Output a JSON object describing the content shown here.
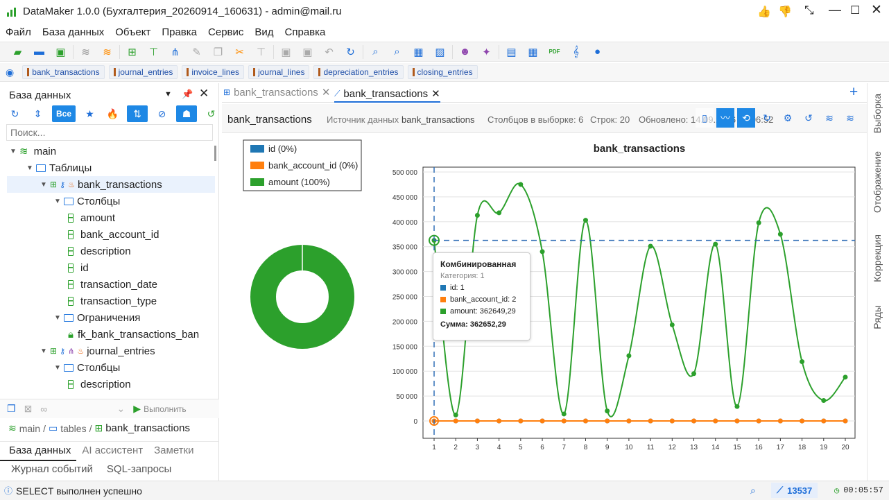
{
  "app": {
    "title": "DataMaker 1.0.0 (Бухгалтерия_20260914_160631) - admin@mail.ru"
  },
  "menu": [
    "Файл",
    "База данных",
    "Объект",
    "Правка",
    "Сервис",
    "Вид",
    "Справка"
  ],
  "table_tabs": [
    "bank_transactions",
    "journal_entries",
    "invoice_lines",
    "journal_lines",
    "depreciation_entries",
    "closing_entries"
  ],
  "left": {
    "header": "База данных",
    "filter_all": "Все",
    "search_placeholder": "Поиск...",
    "tree": [
      {
        "label": "main",
        "kind": "db",
        "depth": 0
      },
      {
        "label": "Таблицы",
        "kind": "folder",
        "depth": 1
      },
      {
        "label": "bank_transactions",
        "kind": "table",
        "depth": 2
      },
      {
        "label": "Столбцы",
        "kind": "folder",
        "depth": 3
      },
      {
        "label": "amount",
        "kind": "col",
        "depth": 4
      },
      {
        "label": "bank_account_id",
        "kind": "col",
        "depth": 4
      },
      {
        "label": "description",
        "kind": "col",
        "depth": 4
      },
      {
        "label": "id",
        "kind": "col",
        "depth": 4
      },
      {
        "label": "transaction_date",
        "kind": "col",
        "depth": 4
      },
      {
        "label": "transaction_type",
        "kind": "col",
        "depth": 4
      },
      {
        "label": "Ограничения",
        "kind": "folder",
        "depth": 3
      },
      {
        "label": "fk_bank_transactions_ban",
        "kind": "fk",
        "depth": 4
      },
      {
        "label": "journal_entries",
        "kind": "table",
        "depth": 2
      },
      {
        "label": "Столбцы",
        "kind": "folder",
        "depth": 3
      },
      {
        "label": "description",
        "kind": "col",
        "depth": 4
      }
    ],
    "run_label": "Выполнить",
    "breadcrumb": [
      "main",
      "tables",
      "bank_transactions"
    ],
    "bottom_tabs": [
      "База данных",
      "AI ассистент",
      "Заметки"
    ],
    "bottom_tabs2": [
      "Журнал событий",
      "SQL-запросы"
    ]
  },
  "doc_tabs": [
    "bank_transactions",
    "bank_transactions"
  ],
  "info": {
    "name": "bank_transactions",
    "source_label": "Источник данных",
    "source_value": "bank_transactions",
    "cols": "Столбцов в выборке: 6",
    "rows": "Строк: 20",
    "updated": "Обновлено: 14.09.2026 16:06:52"
  },
  "right_tabs": [
    "Выборка",
    "Отображение",
    "Коррекция",
    "Ряды"
  ],
  "tooltip": {
    "title": "Комбинированная",
    "category": "Категория: 1",
    "rows": [
      "id: 1",
      "bank_account_id: 2",
      "amount: 362649,29"
    ],
    "sum": "Сумма: 362652,29"
  },
  "status": {
    "message": "SELECT выполнен успешно",
    "count": "13537",
    "time": "00:05:57"
  },
  "colors": {
    "id": "#1f77b4",
    "bank_account_id": "#ff7f0e",
    "amount": "#2ca02c",
    "accent": "#1e88e5"
  },
  "chart_data": [
    {
      "type": "pie",
      "legend": [
        "id (0%)",
        "bank_account_id (0%)",
        "amount (100%)"
      ],
      "values": [
        0,
        0,
        100
      ]
    },
    {
      "type": "line",
      "title": "bank_transactions",
      "categories": [
        1,
        2,
        3,
        4,
        5,
        6,
        7,
        8,
        9,
        10,
        11,
        12,
        13,
        14,
        15,
        16,
        17,
        18,
        19,
        20
      ],
      "ylim": [
        0,
        500000
      ],
      "yticks": [
        "0",
        "50 000",
        "100 000",
        "150 000",
        "200 000",
        "250 000",
        "300 000",
        "350 000",
        "400 000",
        "450 000",
        "500 000"
      ],
      "series": [
        {
          "name": "id",
          "values": [
            1,
            2,
            3,
            4,
            5,
            6,
            7,
            8,
            9,
            10,
            11,
            12,
            13,
            14,
            15,
            16,
            17,
            18,
            19,
            20
          ]
        },
        {
          "name": "bank_account_id",
          "values": [
            2,
            1,
            3,
            2,
            1,
            3,
            2,
            1,
            2,
            3,
            1,
            2,
            3,
            1,
            2,
            3,
            1,
            2,
            3,
            1
          ]
        },
        {
          "name": "amount",
          "values": [
            362649,
            12000,
            413000,
            418000,
            475000,
            340000,
            14000,
            403000,
            20000,
            131000,
            351000,
            193000,
            95000,
            355000,
            29000,
            398000,
            375000,
            119000,
            41000,
            88000
          ]
        }
      ],
      "crosshair_y": 362649
    }
  ]
}
